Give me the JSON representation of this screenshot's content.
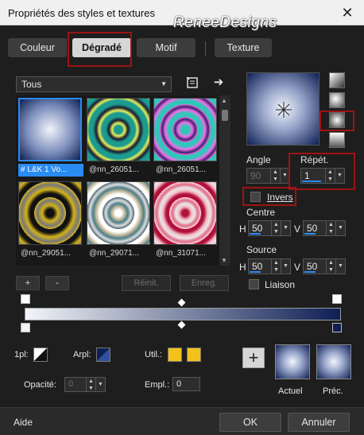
{
  "window": {
    "title": "Propriétés des styles et textures",
    "watermark": "ReneeDesigns",
    "close": "✕"
  },
  "tabs": [
    {
      "label": "Couleur"
    },
    {
      "label": "Dégradé",
      "active": true
    },
    {
      "label": "Motif"
    },
    {
      "label": "Texture"
    }
  ],
  "library": {
    "category": "Tous",
    "items": [
      {
        "caption": "# L&K 1 Vo...",
        "selected": true
      },
      {
        "caption": "@nn_26051..."
      },
      {
        "caption": "@nn_26051..."
      },
      {
        "caption": "@nn_29051..."
      },
      {
        "caption": "@nn_29071..."
      },
      {
        "caption": "@nn_31071..."
      }
    ],
    "add_label": "+",
    "remove_label": "-",
    "reset_label": "Réinit.",
    "save_label": "Enreg."
  },
  "gradient": {
    "angle_label": "Angle",
    "angle_value": "90",
    "repeat_label": "Répét.",
    "repeat_value": "1",
    "invert_label": "Invers",
    "center_label": "Centre",
    "center_h": "50",
    "center_v": "50",
    "source_label": "Source",
    "source_h": "50",
    "source_v": "50",
    "h_label": "H",
    "v_label": "V",
    "link_label": "Liaison",
    "start_color": "#f2f4f9",
    "end_color": "#0e1f54"
  },
  "bottom": {
    "plan_label": "1pl:",
    "arpl_label": "Arpl:",
    "util_label": "Util.:",
    "util_color_1": "#f2c11b",
    "util_color_2": "#f2c11b",
    "opacity_label": "Opacité:",
    "opacity_value": "0",
    "empl_label": "Empl.:",
    "empl_value": "0",
    "add_label": "+",
    "current_label": "Actuel",
    "previous_label": "Préc."
  },
  "footer": {
    "help_label": "Aide",
    "ok_label": "OK",
    "cancel_label": "Annuler"
  },
  "colors": {
    "accent": "#2a8bf2",
    "highlight": "#9b1414"
  }
}
